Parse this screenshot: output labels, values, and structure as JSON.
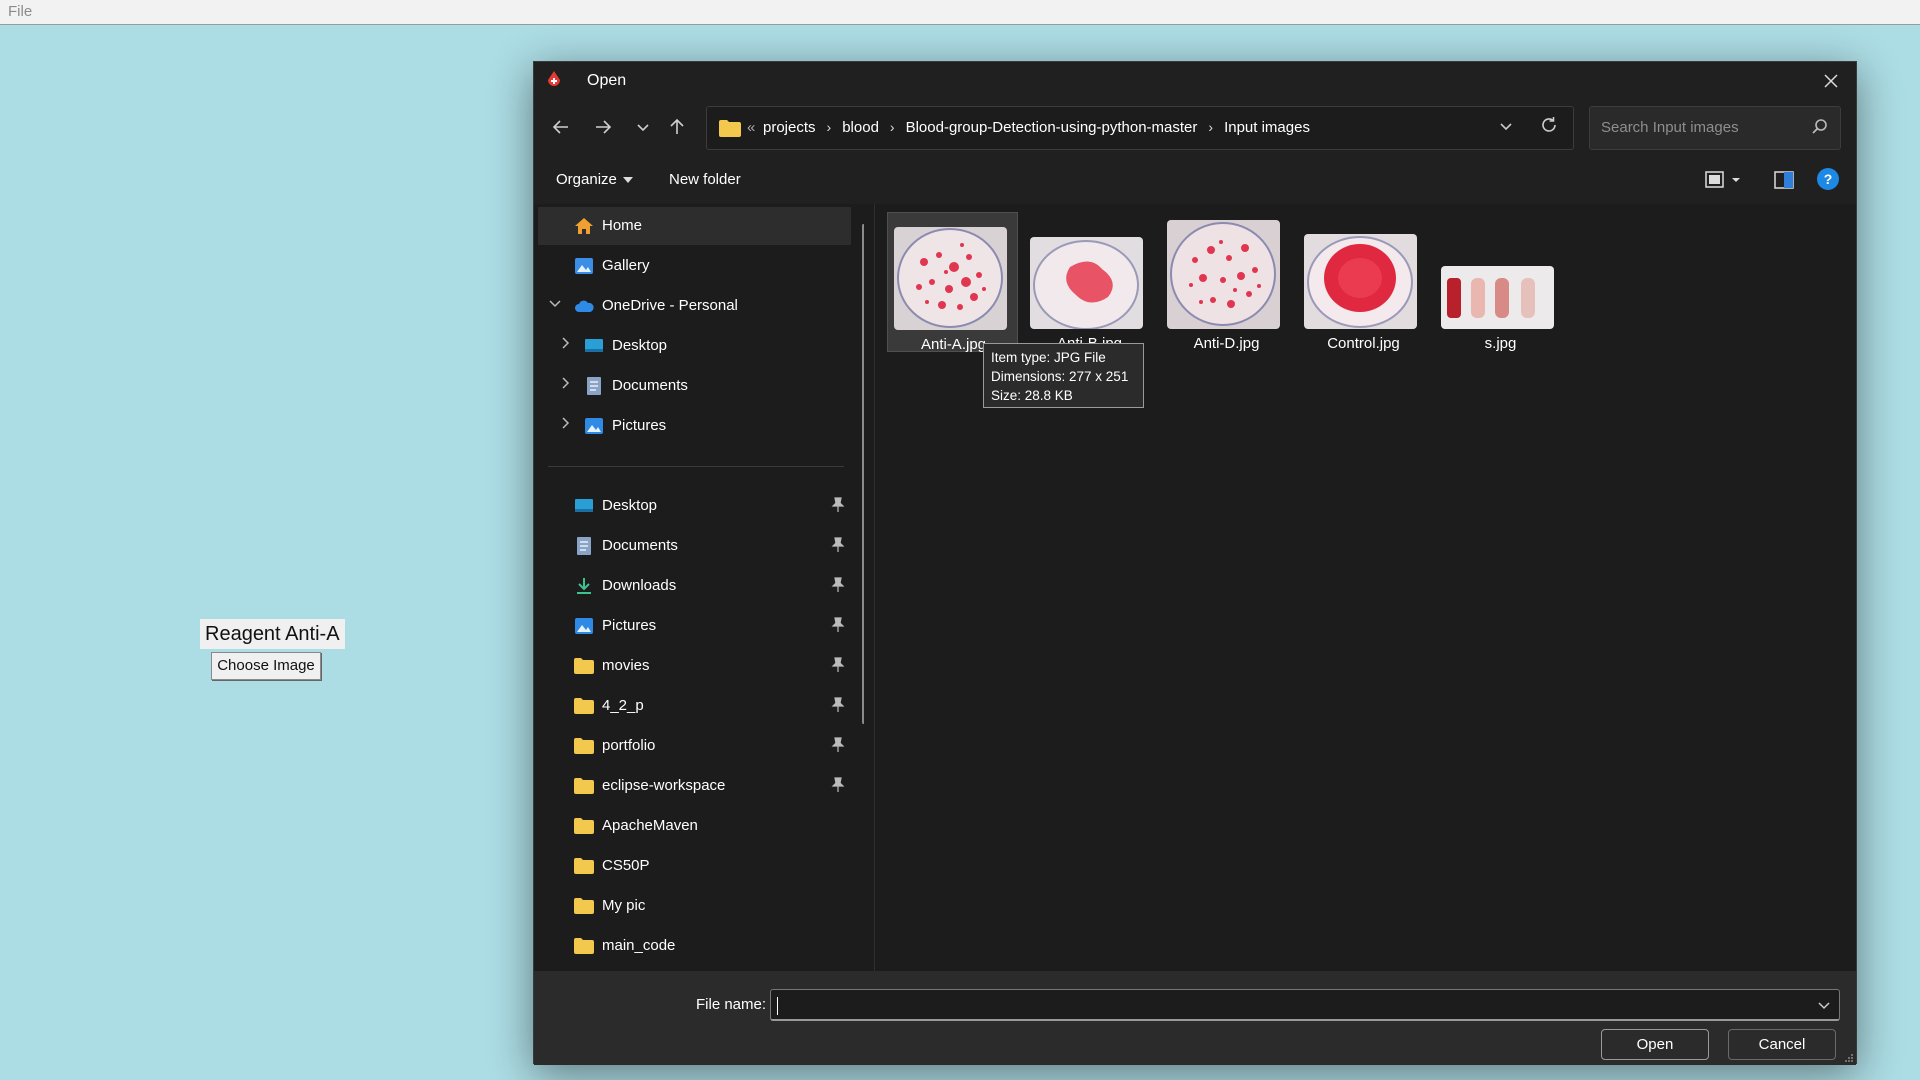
{
  "app": {
    "menu_file": "File",
    "reagent_label": "Reagent Anti-A",
    "choose_button": "Choose Image"
  },
  "dialog": {
    "title": "Open",
    "close_icon": "close-icon",
    "address": {
      "overflow_marker": "«",
      "crumbs": [
        "projects",
        "blood",
        "Blood-group-Detection-using-python-master",
        "Input images"
      ]
    },
    "search": {
      "placeholder": "Search Input images"
    },
    "commands": {
      "organize": "Organize",
      "new_folder": "New folder",
      "help": "?"
    },
    "nav": {
      "quick": [
        {
          "label": "Home",
          "icon": "home-icon",
          "selected": true
        },
        {
          "label": "Gallery",
          "icon": "gallery-icon"
        },
        {
          "label": "OneDrive - Personal",
          "icon": "cloud-icon",
          "expanded": true
        },
        {
          "label": "Desktop",
          "icon": "desktop-icon"
        },
        {
          "label": "Documents",
          "icon": "documents-icon"
        },
        {
          "label": "Pictures",
          "icon": "pictures-icon"
        }
      ],
      "pinned": [
        {
          "label": "Desktop",
          "icon": "desktop-icon",
          "pinned": true
        },
        {
          "label": "Documents",
          "icon": "documents-icon",
          "pinned": true
        },
        {
          "label": "Downloads",
          "icon": "download-icon",
          "pinned": true
        },
        {
          "label": "Pictures",
          "icon": "pictures-icon",
          "pinned": true
        },
        {
          "label": "movies",
          "icon": "folder-icon",
          "pinned": true
        },
        {
          "label": "4_2_p",
          "icon": "folder-icon",
          "pinned": true
        },
        {
          "label": "portfolio",
          "icon": "folder-icon",
          "pinned": true
        },
        {
          "label": "eclipse-workspace",
          "icon": "folder-icon",
          "pinned": true
        },
        {
          "label": "ApacheMaven",
          "icon": "folder-icon"
        },
        {
          "label": "CS50P",
          "icon": "folder-icon"
        },
        {
          "label": "My pic",
          "icon": "folder-icon"
        },
        {
          "label": "main_code",
          "icon": "folder-icon"
        }
      ]
    },
    "files": [
      {
        "name": "Anti-A.jpg",
        "selected": true
      },
      {
        "name": "Anti-B.jpg"
      },
      {
        "name": "Anti-D.jpg"
      },
      {
        "name": "Control.jpg"
      },
      {
        "name": "s.jpg"
      }
    ],
    "tooltip": {
      "line1": "Item type: JPG File",
      "line2": "Dimensions: 277 x 251",
      "line3": "Size: 28.8 KB"
    },
    "footer": {
      "file_name_label": "File name:",
      "file_name_value": "",
      "open": "Open",
      "cancel": "Cancel"
    }
  },
  "colors": {
    "desktop_bg": "#acdce4",
    "dialog_bg": "#1c1c1c",
    "accent_blue": "#1e88e5",
    "folder_yellow": "#f2c94c"
  }
}
